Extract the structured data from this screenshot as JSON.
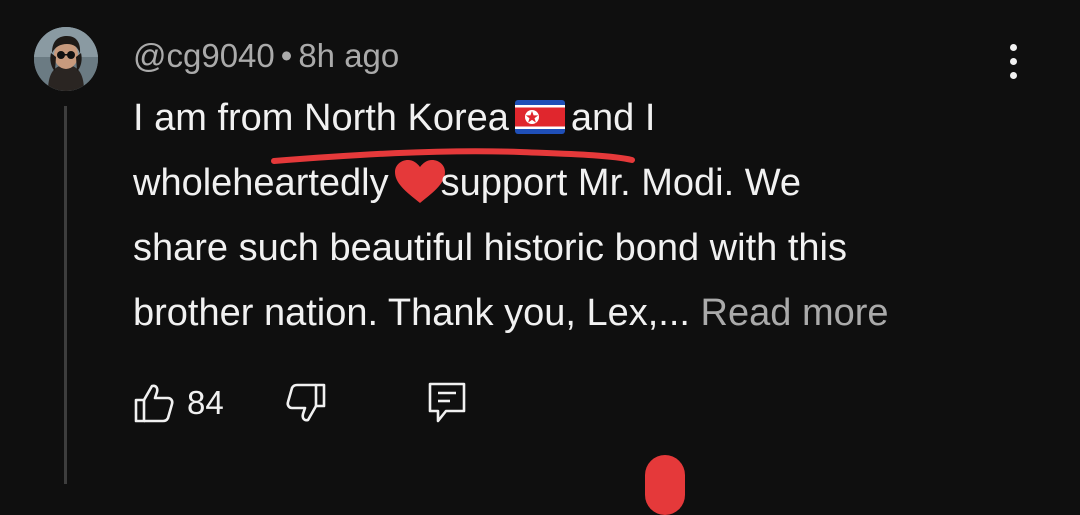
{
  "comment": {
    "author": "@cg9040",
    "separator": "•",
    "time": "8h ago",
    "text_line1_a": "I am from North Korea",
    "text_line1_b": "and I",
    "text_line2_a": "wholeheartedly",
    "text_line2_b": "support Mr. Modi. We",
    "text_line3": "share such beautiful historic bond with this",
    "text_line4": "brother nation. Thank you, Lex,...",
    "read_more": "Read more"
  },
  "actions": {
    "like_count": "84"
  },
  "icons": {
    "flag": "north-korea-flag-icon",
    "heart": "red-heart-icon",
    "like": "thumbs-up-icon",
    "dislike": "thumbs-down-icon",
    "reply": "reply-comment-icon",
    "more": "more-vertical-icon"
  },
  "colors": {
    "background": "#0f0f0f",
    "text": "#f1f1f1",
    "secondary_text": "#aaaaaa",
    "annotation_red": "#e5393a"
  }
}
